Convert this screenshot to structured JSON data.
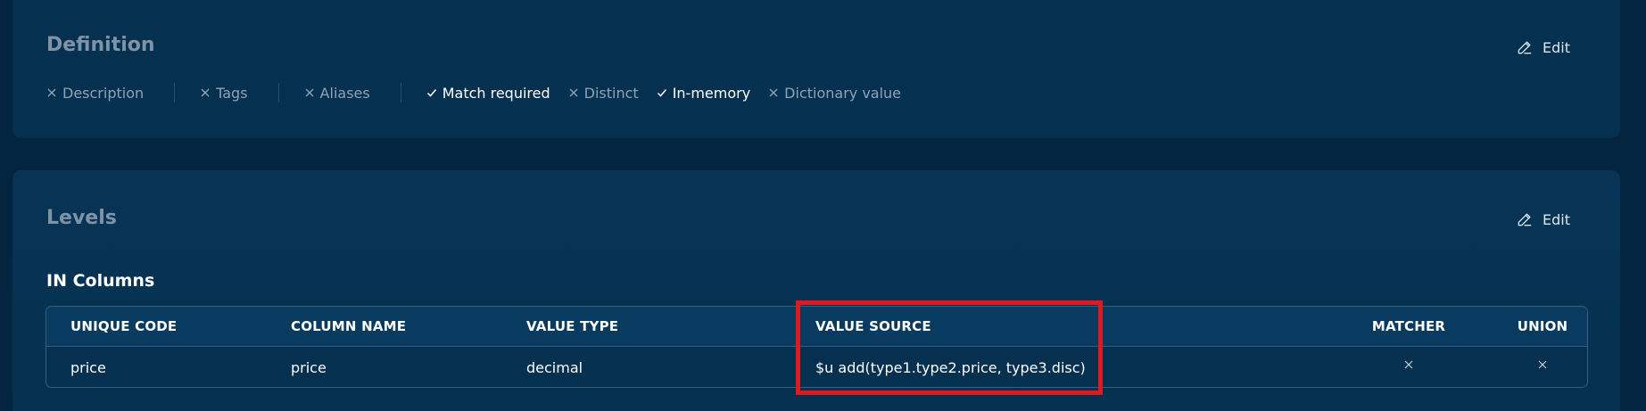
{
  "definition": {
    "title": "Definition",
    "edit_label": "Edit",
    "flags": [
      {
        "label": "Description",
        "state": "off"
      },
      {
        "label": "Tags",
        "state": "off"
      },
      {
        "label": "Aliases",
        "state": "off"
      },
      {
        "label": "Match required",
        "state": "on"
      },
      {
        "label": "Distinct",
        "state": "off"
      },
      {
        "label": "In-memory",
        "state": "on"
      },
      {
        "label": "Dictionary value",
        "state": "off"
      }
    ]
  },
  "levels": {
    "title": "Levels",
    "edit_label": "Edit",
    "section_title": "IN Columns",
    "table": {
      "headers": [
        "UNIQUE CODE",
        "COLUMN NAME",
        "VALUE TYPE",
        "VALUE SOURCE",
        "MATCHER",
        "UNION"
      ],
      "rows": [
        [
          "price",
          "price",
          "decimal",
          "$u add(type1.type2.price, type3.disc)",
          "x-icon",
          "x-icon"
        ]
      ]
    }
  },
  "colors": {
    "background": "#042540",
    "card": "#06304f",
    "table_header": "#093a5f",
    "muted_text": "#8ea3b5",
    "highlight": "#e0191f"
  }
}
